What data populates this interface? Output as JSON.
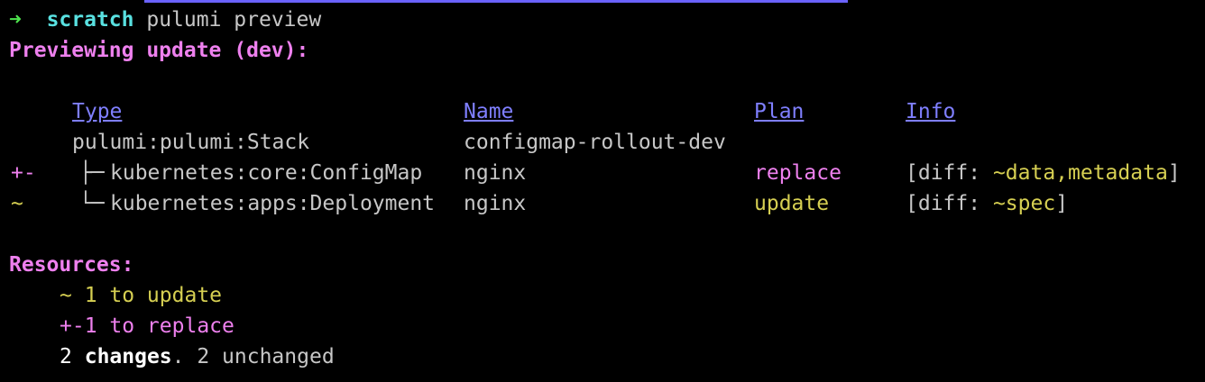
{
  "prompt": {
    "arrow": "➜",
    "directory": "scratch",
    "command": "pulumi preview"
  },
  "previewing": "Previewing update (dev):",
  "table": {
    "headers": {
      "type": "Type",
      "name": "Name",
      "plan": "Plan",
      "info": "Info"
    },
    "rows": [
      {
        "marker": "",
        "tree": "",
        "type": "pulumi:pulumi:Stack",
        "name": "configmap-rollout-dev",
        "plan": "",
        "info_prefix": "",
        "info_value": "",
        "info_suffix": ""
      },
      {
        "marker": "+-",
        "tree": "├─",
        "type": "kubernetes:core:ConfigMap",
        "name": "nginx",
        "plan": "replace",
        "info_prefix": "[diff: ",
        "info_value": "~data,metadata",
        "info_suffix": "]"
      },
      {
        "marker": "~",
        "tree": "└─",
        "type": "kubernetes:apps:Deployment",
        "name": "nginx",
        "plan": "update",
        "info_prefix": "[diff: ",
        "info_value": "~spec",
        "info_suffix": "]"
      }
    ]
  },
  "resources": {
    "title": "Resources:",
    "update_line": "~ 1 to update",
    "replace_line": "+-1 to replace",
    "changes_count": "2",
    "changes_word": "changes",
    "unchanged_text": ". 2 unchanged"
  }
}
